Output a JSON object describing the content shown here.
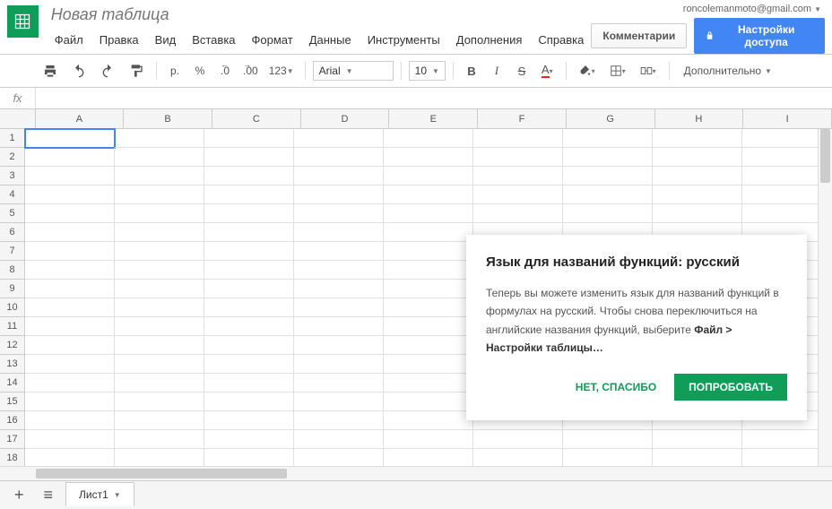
{
  "user_email": "roncolemanmoto@gmail.com",
  "doc_title": "Новая таблица",
  "menus": [
    "Файл",
    "Правка",
    "Вид",
    "Вставка",
    "Формат",
    "Данные",
    "Инструменты",
    "Дополнения",
    "Справка"
  ],
  "btn_comments": "Комментарии",
  "btn_share": "Настройки доступа",
  "toolbar": {
    "currency": "р.",
    "percent": "%",
    "dec_dec": ".0",
    "dec_inc": ".00",
    "num_format": "123",
    "font": "Arial",
    "size": "10",
    "bold": "B",
    "italic": "I",
    "strike": "S",
    "textcolor": "A",
    "more": "Дополнительно"
  },
  "fx_label": "fx",
  "columns": [
    "A",
    "B",
    "C",
    "D",
    "E",
    "F",
    "G",
    "H",
    "I"
  ],
  "rows": [
    1,
    2,
    3,
    4,
    5,
    6,
    7,
    8,
    9,
    10,
    11,
    12,
    13,
    14,
    15,
    16,
    17,
    18
  ],
  "selected_cell": {
    "row": 1,
    "col": "A"
  },
  "sheet_tab": "Лист1",
  "add_sheet": "+",
  "all_sheets": "≡",
  "popup": {
    "title": "Язык для названий функций: русский",
    "body_1": "Теперь вы можете изменить язык для названий функций в формулах на русский. Чтобы снова переключиться на английские названия функций, выберите ",
    "body_bold": "Файл > Настройки таблицы…",
    "no": "НЕТ, СПАСИБО",
    "yes": "ПОПРОБОВАТЬ"
  }
}
